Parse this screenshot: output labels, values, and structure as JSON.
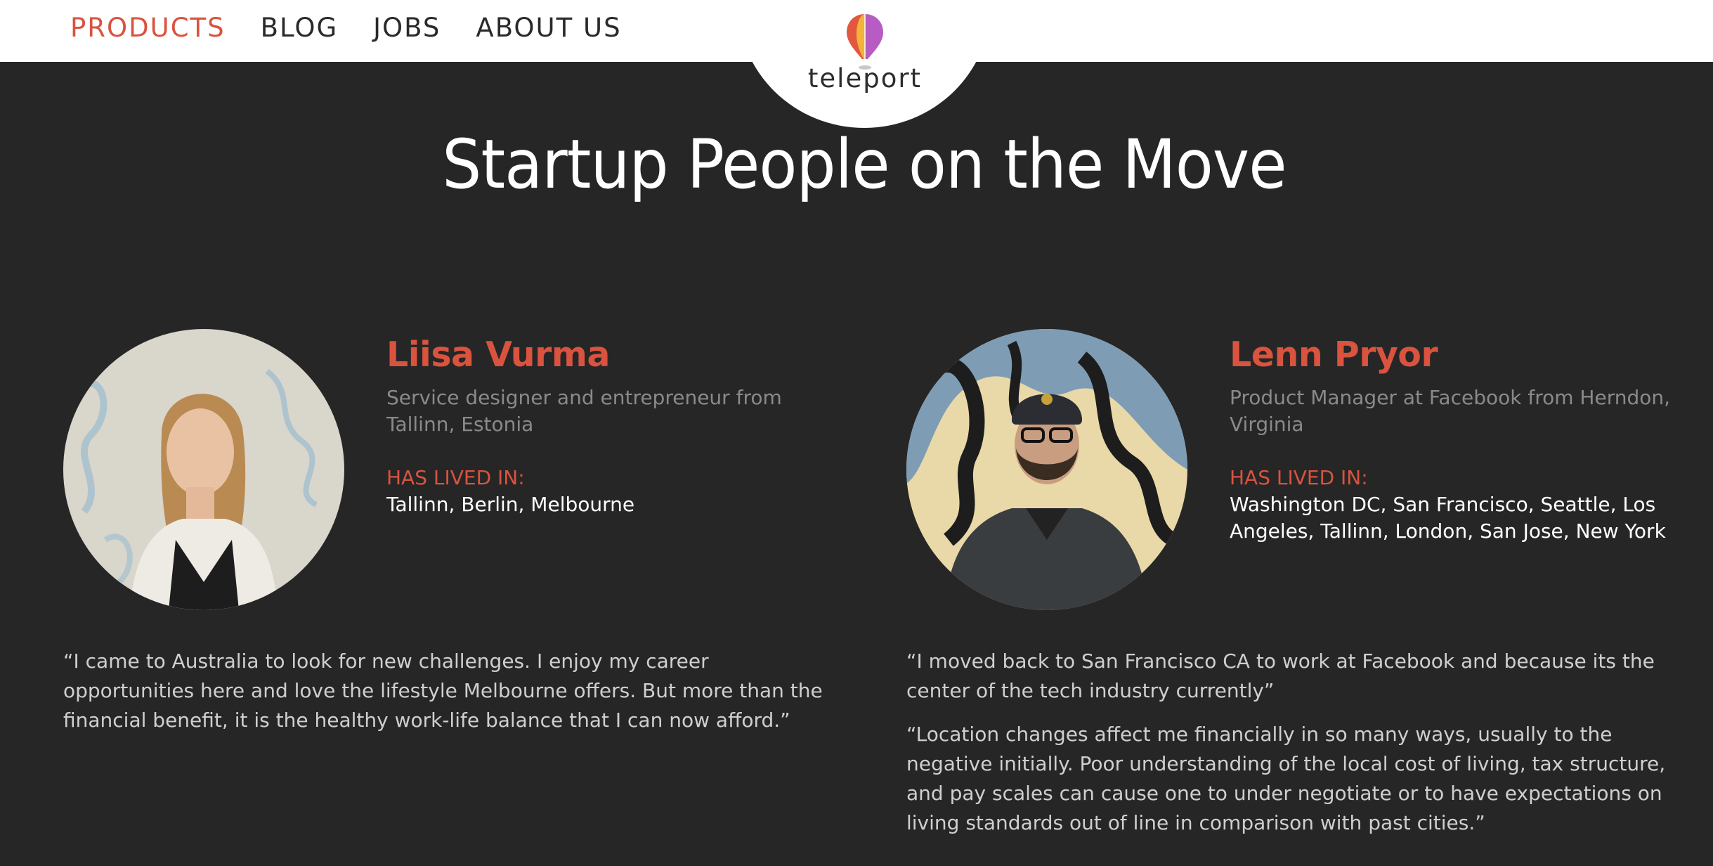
{
  "nav": {
    "items": [
      {
        "label": "PRODUCTS",
        "active": true
      },
      {
        "label": "BLOG",
        "active": false
      },
      {
        "label": "JOBS",
        "active": false
      },
      {
        "label": "ABOUT US",
        "active": false
      }
    ]
  },
  "logo": {
    "text": "teleport",
    "icon": "hot-air-balloon-icon"
  },
  "page_title": "Startup People on the Move",
  "people": [
    {
      "name": "Liisa Vurma",
      "role": "Service designer and entrepreneur from Tallinn, Estonia",
      "lived_label": "HAS LIVED IN:",
      "lived_in": "Tallinn, Berlin, Melbourne",
      "quotes": [
        "“I came to Australia to look for new challenges. I enjoy my career opportunities here and love the lifestyle Melbourne offers. But more than the financial benefit, it is the healthy work-life balance that I can now afford.”"
      ]
    },
    {
      "name": "Lenn Pryor",
      "role": "Product Manager at Facebook from Herndon, Virginia",
      "lived_label": "HAS LIVED IN:",
      "lived_in": "Washington DC, San Francisco, Seattle, Los Angeles, Tallinn, London, San Jose, New York",
      "quotes": [
        "“I moved back to San Francisco CA to work at Facebook and because its the center of the tech industry currently”",
        "“Location changes affect me financially in so many ways, usually to the negative initially. Poor understanding of the local cost of living, tax structure, and pay scales can cause one to under negotiate or to have expectations on living standards out of line in comparison with past cities.”"
      ]
    }
  ],
  "colors": {
    "accent": "#d9533f",
    "background": "#262626",
    "header": "#ffffff",
    "muted_text": "#8a8a8a",
    "quote_text": "#cfcfcf"
  }
}
